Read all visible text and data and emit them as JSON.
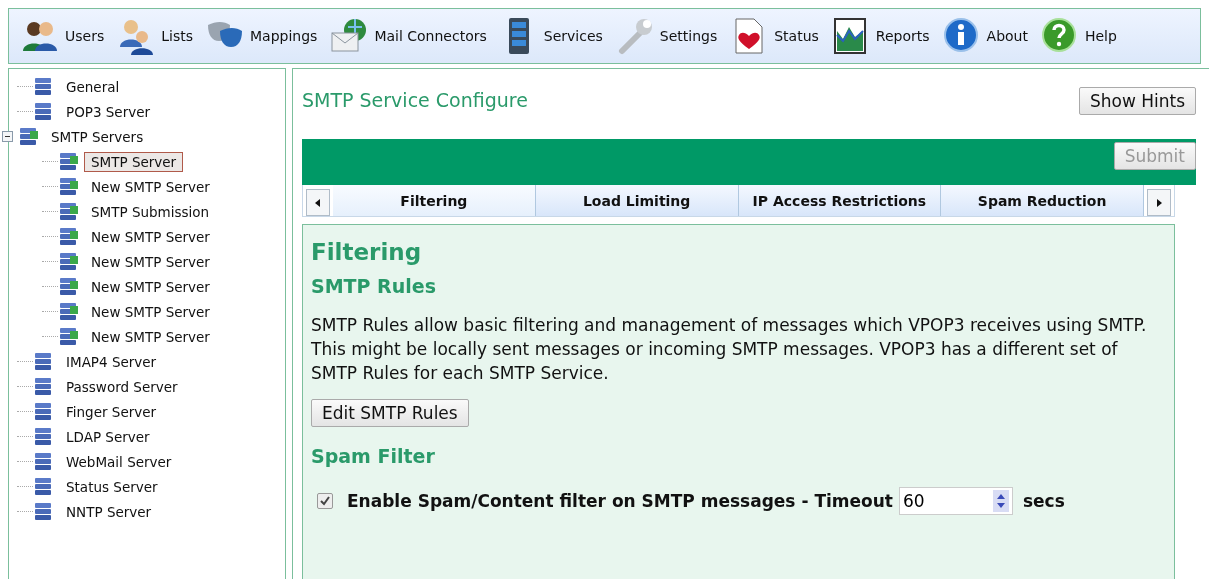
{
  "toolbar": [
    {
      "label": "Users"
    },
    {
      "label": "Lists"
    },
    {
      "label": "Mappings"
    },
    {
      "label": "Mail Connectors"
    },
    {
      "label": "Services"
    },
    {
      "label": "Settings"
    },
    {
      "label": "Status"
    },
    {
      "label": "Reports"
    },
    {
      "label": "About"
    },
    {
      "label": "Help"
    }
  ],
  "tree": [
    {
      "label": "General",
      "selected": false
    },
    {
      "label": "POP3 Server",
      "selected": false
    },
    {
      "label": "SMTP Servers",
      "selected": false,
      "expanded": true,
      "children": [
        {
          "label": "SMTP Server",
          "selected": true
        },
        {
          "label": "New SMTP Server",
          "selected": false
        },
        {
          "label": "SMTP Submission",
          "selected": false
        },
        {
          "label": "New SMTP Server",
          "selected": false
        },
        {
          "label": "New SMTP Server",
          "selected": false
        },
        {
          "label": "New SMTP Server",
          "selected": false
        },
        {
          "label": "New SMTP Server",
          "selected": false
        },
        {
          "label": "New SMTP Server",
          "selected": false
        }
      ]
    },
    {
      "label": "IMAP4 Server",
      "selected": false
    },
    {
      "label": "Password Server",
      "selected": false
    },
    {
      "label": "Finger Server",
      "selected": false
    },
    {
      "label": "LDAP Server",
      "selected": false
    },
    {
      "label": "WebMail Server",
      "selected": false
    },
    {
      "label": "Status Server",
      "selected": false
    },
    {
      "label": "NNTP Server",
      "selected": false
    }
  ],
  "page": {
    "title": "SMTP Service Configure",
    "hints_button": "Show Hints",
    "submit_button": {
      "label": "Submit",
      "disabled": true
    }
  },
  "tabs": [
    {
      "label": "Filtering",
      "selected": true
    },
    {
      "label": "Load Limiting",
      "selected": false
    },
    {
      "label": "IP Access Restrictions",
      "selected": false
    },
    {
      "label": "Spam Reduction",
      "selected": false
    }
  ],
  "content": {
    "heading": "Filtering",
    "rules_heading": "SMTP Rules",
    "rules_text": "SMTP Rules allow basic filtering and management of messages which VPOP3 receives using SMTP. This might be locally sent messages or incoming SMTP messages. VPOP3 has a different set of SMTP Rules for each SMTP Service.",
    "rules_button": "Edit SMTP Rules",
    "spam_heading": "Spam Filter",
    "spam_option": {
      "label": "Enable Spam/Content filter on SMTP messages - Timeout",
      "checked": true,
      "timeout": "60",
      "unit": "secs"
    }
  }
}
